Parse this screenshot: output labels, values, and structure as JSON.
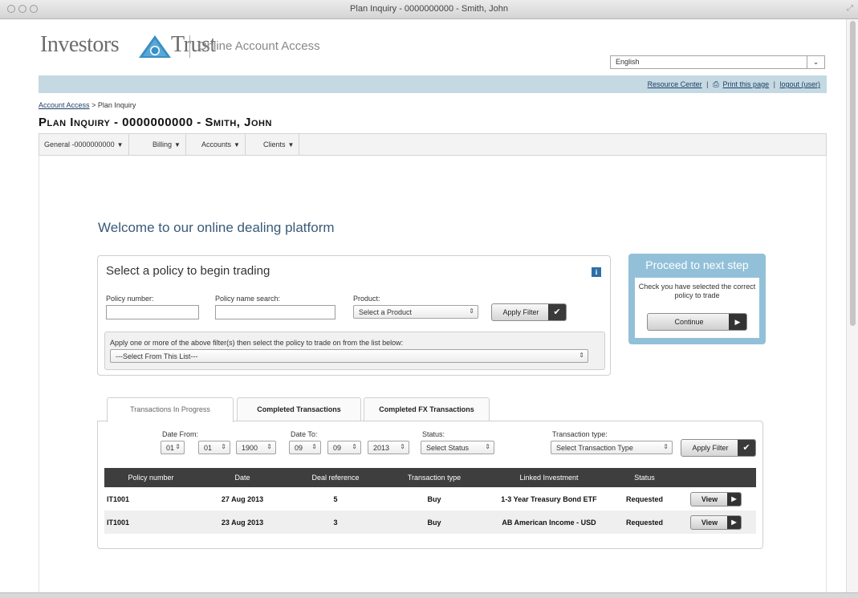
{
  "window": {
    "title": "Plan Inquiry - 0000000000 - Smith, John"
  },
  "header": {
    "logo_left": "Investors",
    "logo_right": "Trust",
    "logo_emblem_text": "INVESTORS TRUST",
    "subtitle": "Online Account Access",
    "language": "English"
  },
  "toplinks": {
    "resource_center": "Resource Center",
    "print": "Print this page",
    "logout": "logout (user)",
    "separator": "|"
  },
  "breadcrumb": {
    "root": "Account Access",
    "sep": ">",
    "current": "Plan Inquiry"
  },
  "page_title": "Plan Inquiry - 0000000000 - Smith, John",
  "menu": {
    "items": [
      {
        "label": "General -0000000000"
      },
      {
        "label": "Billing"
      },
      {
        "label": "Accounts"
      },
      {
        "label": "Clients"
      }
    ],
    "chevron": "▼"
  },
  "welcome": "Welcome to our online dealing platform",
  "policy": {
    "heading": "Select a policy to begin trading",
    "info_icon": "i",
    "policy_number_label": "Policy number:",
    "policy_number_value": "",
    "policy_name_label": "Policy name search:",
    "policy_name_value": "",
    "product_label": "Product:",
    "product_value": "Select a Product",
    "apply_filter": "Apply Filter",
    "instruction": "Apply one or more of the above filter(s) then select the policy to trade on from the list below:",
    "list_value": "---Select From This List---"
  },
  "proceed": {
    "title": "Proceed to next step",
    "text": "Check you have selected the correct policy to trade",
    "button": "Continue"
  },
  "tabs": [
    {
      "label": "Transactions In Progress",
      "active": true
    },
    {
      "label": "Completed Transactions",
      "active": false
    },
    {
      "label": "Completed FX Transactions",
      "active": false
    }
  ],
  "filters": {
    "date_from_label": "Date From:",
    "date_from": {
      "day": "01",
      "month": "01",
      "year": "1900"
    },
    "date_to_label": "Date To:",
    "date_to": {
      "day": "09",
      "month": "09",
      "year": "2013"
    },
    "status_label": "Status:",
    "status_value": "Select Status",
    "type_label": "Transaction type:",
    "type_value": "Select Transaction Type",
    "apply_filter": "Apply Filter"
  },
  "table": {
    "headers": [
      "Policy number",
      "Date",
      "Deal reference",
      "Transaction type",
      "Linked Investment",
      "Status",
      ""
    ],
    "rows": [
      {
        "policy": "IT1001",
        "date": "27 Aug 2013",
        "ref": "5",
        "type": "Buy",
        "investment": "1-3 Year Treasury Bond ETF",
        "status": "Requested",
        "action": "View"
      },
      {
        "policy": "IT1001",
        "date": "23 Aug 2013",
        "ref": "3",
        "type": "Buy",
        "investment": "AB American Income - USD",
        "status": "Requested",
        "action": "View"
      }
    ]
  },
  "colors": {
    "topbar": "#c4d9e2",
    "proceed": "#93c0d9",
    "table_header": "#3e3e3e",
    "logo_blue": "#3a8fc4"
  }
}
